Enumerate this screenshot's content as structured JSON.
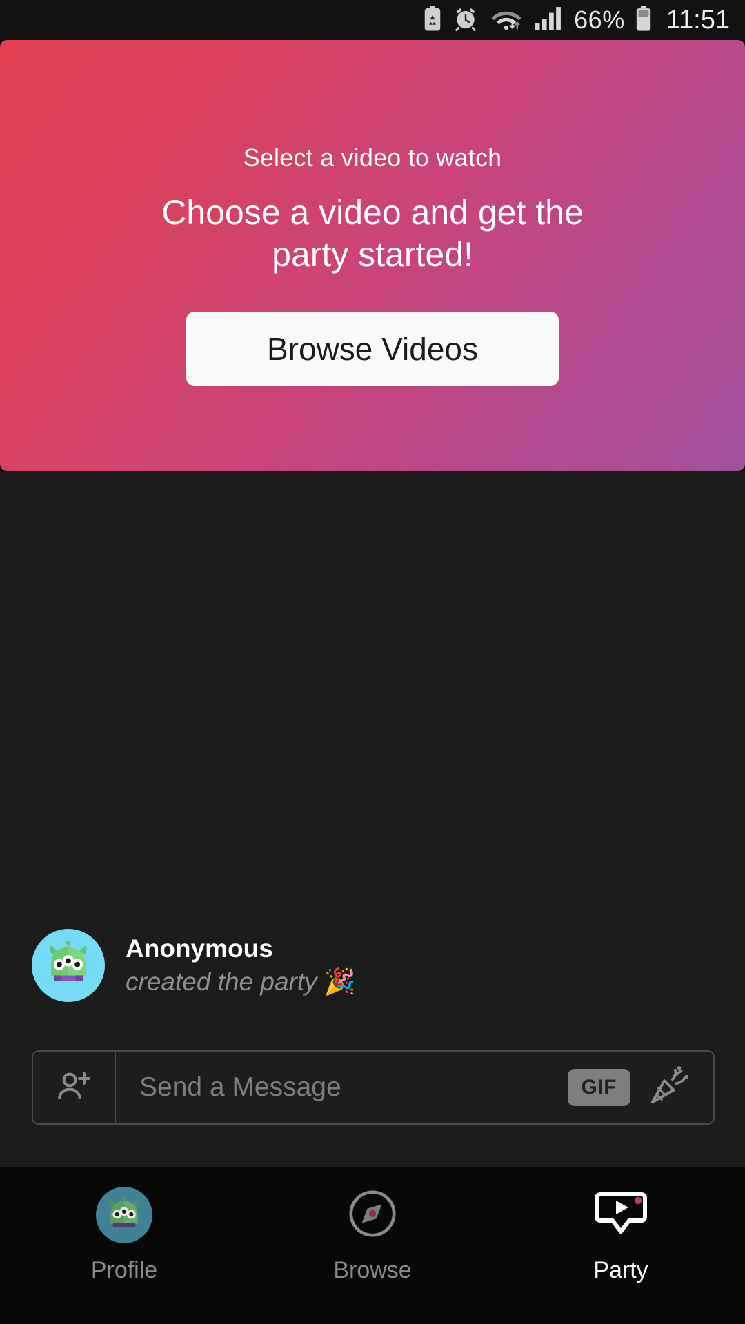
{
  "status_bar": {
    "icons": [
      "recycling-battery-icon",
      "alarm-clock-icon",
      "wifi-icon",
      "signal-bars-icon"
    ],
    "battery_percent": "66%",
    "battery_icon": "battery-icon",
    "time": "11:51"
  },
  "hero": {
    "subtitle": "Select a video to watch",
    "title": "Choose a video and get the party started!",
    "browse_button": "Browse Videos",
    "gradient_start": "#e0404f",
    "gradient_end": "#a2519c",
    "button_bg": "#fafafa"
  },
  "chat": {
    "message": {
      "avatar": "alien-avatar",
      "author": "Anonymous",
      "body": "created the party",
      "emoji": "🎉"
    }
  },
  "composer": {
    "add_user_icon": "add-person-icon",
    "placeholder": "Send a Message",
    "value": "",
    "gif_label": "GIF",
    "popper_icon": "party-popper-icon"
  },
  "bottom_nav": {
    "items": [
      {
        "label": "Profile",
        "icon": "alien-avatar-icon",
        "active": false
      },
      {
        "label": "Browse",
        "icon": "compass-icon",
        "active": false
      },
      {
        "label": "Party",
        "icon": "video-bubble-icon",
        "active": true
      }
    ],
    "badge_color": "#c2386b"
  }
}
